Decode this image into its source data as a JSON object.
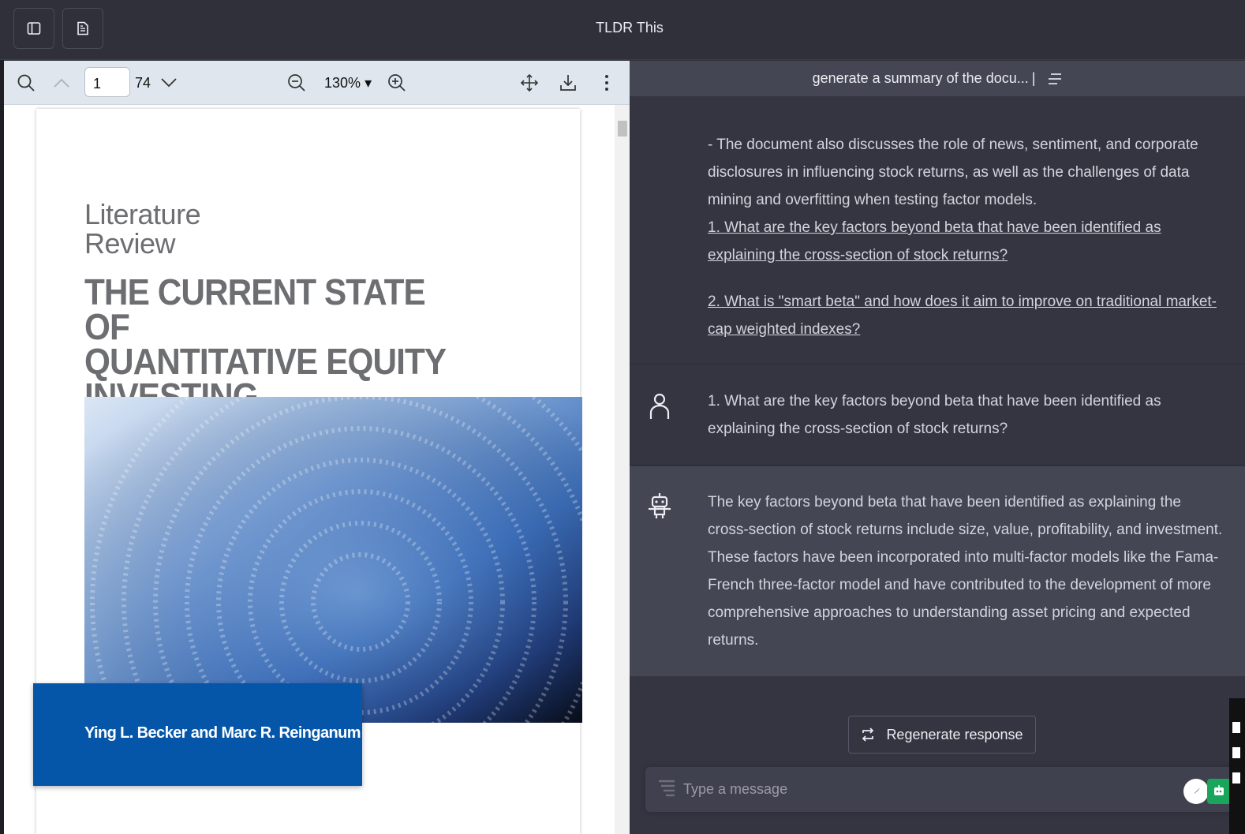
{
  "app": {
    "title": "TLDR This"
  },
  "topbar": {
    "sidebar_icon": "sidebar-toggle-icon",
    "document_icon": "document-icon"
  },
  "pdf_toolbar": {
    "current_page": "1",
    "total_pages": "74",
    "zoom": "130%",
    "zoom_caret": "▾"
  },
  "pdf_document": {
    "kicker_line1": "Literature",
    "kicker_line2": "Review",
    "title_line1": "THE CURRENT STATE OF",
    "title_line2": "QUANTITATIVE EQUITY",
    "title_line3": "INVESTING",
    "authors": "Ying L. Becker and Marc R. Reinganum"
  },
  "chat": {
    "header": "generate a summary of the docu...",
    "summary_tail": "- The document also discusses the role of news, sentiment, and corporate disclosures in influencing stock returns, as well as the challenges of data mining and overfitting when testing factor models.",
    "suggested_questions": [
      "1. What are the key factors beyond beta that have been identified as explaining the cross-section of stock returns?",
      "2. What is \"smart beta\" and how does it aim to improve on traditional market-cap weighted indexes?"
    ],
    "user_message": "1. What are the key factors beyond beta that have been identified as explaining the cross-section of stock returns?",
    "bot_message": "The key factors beyond beta that have been identified as explaining the cross-section of stock returns include size, value, profitability, and investment. These factors have been incorporated into multi-factor models like the Fama-French three-factor model and have contributed to the development of more comprehensive approaches to understanding asset pricing and expected returns.",
    "regenerate_label": "Regenerate response",
    "input_placeholder": "Type a message"
  },
  "colors": {
    "chat_bg": "#343541",
    "bot_bg": "#444654",
    "author_box": "#0556a8",
    "pdf_toolbar": "#dfe6ee"
  }
}
